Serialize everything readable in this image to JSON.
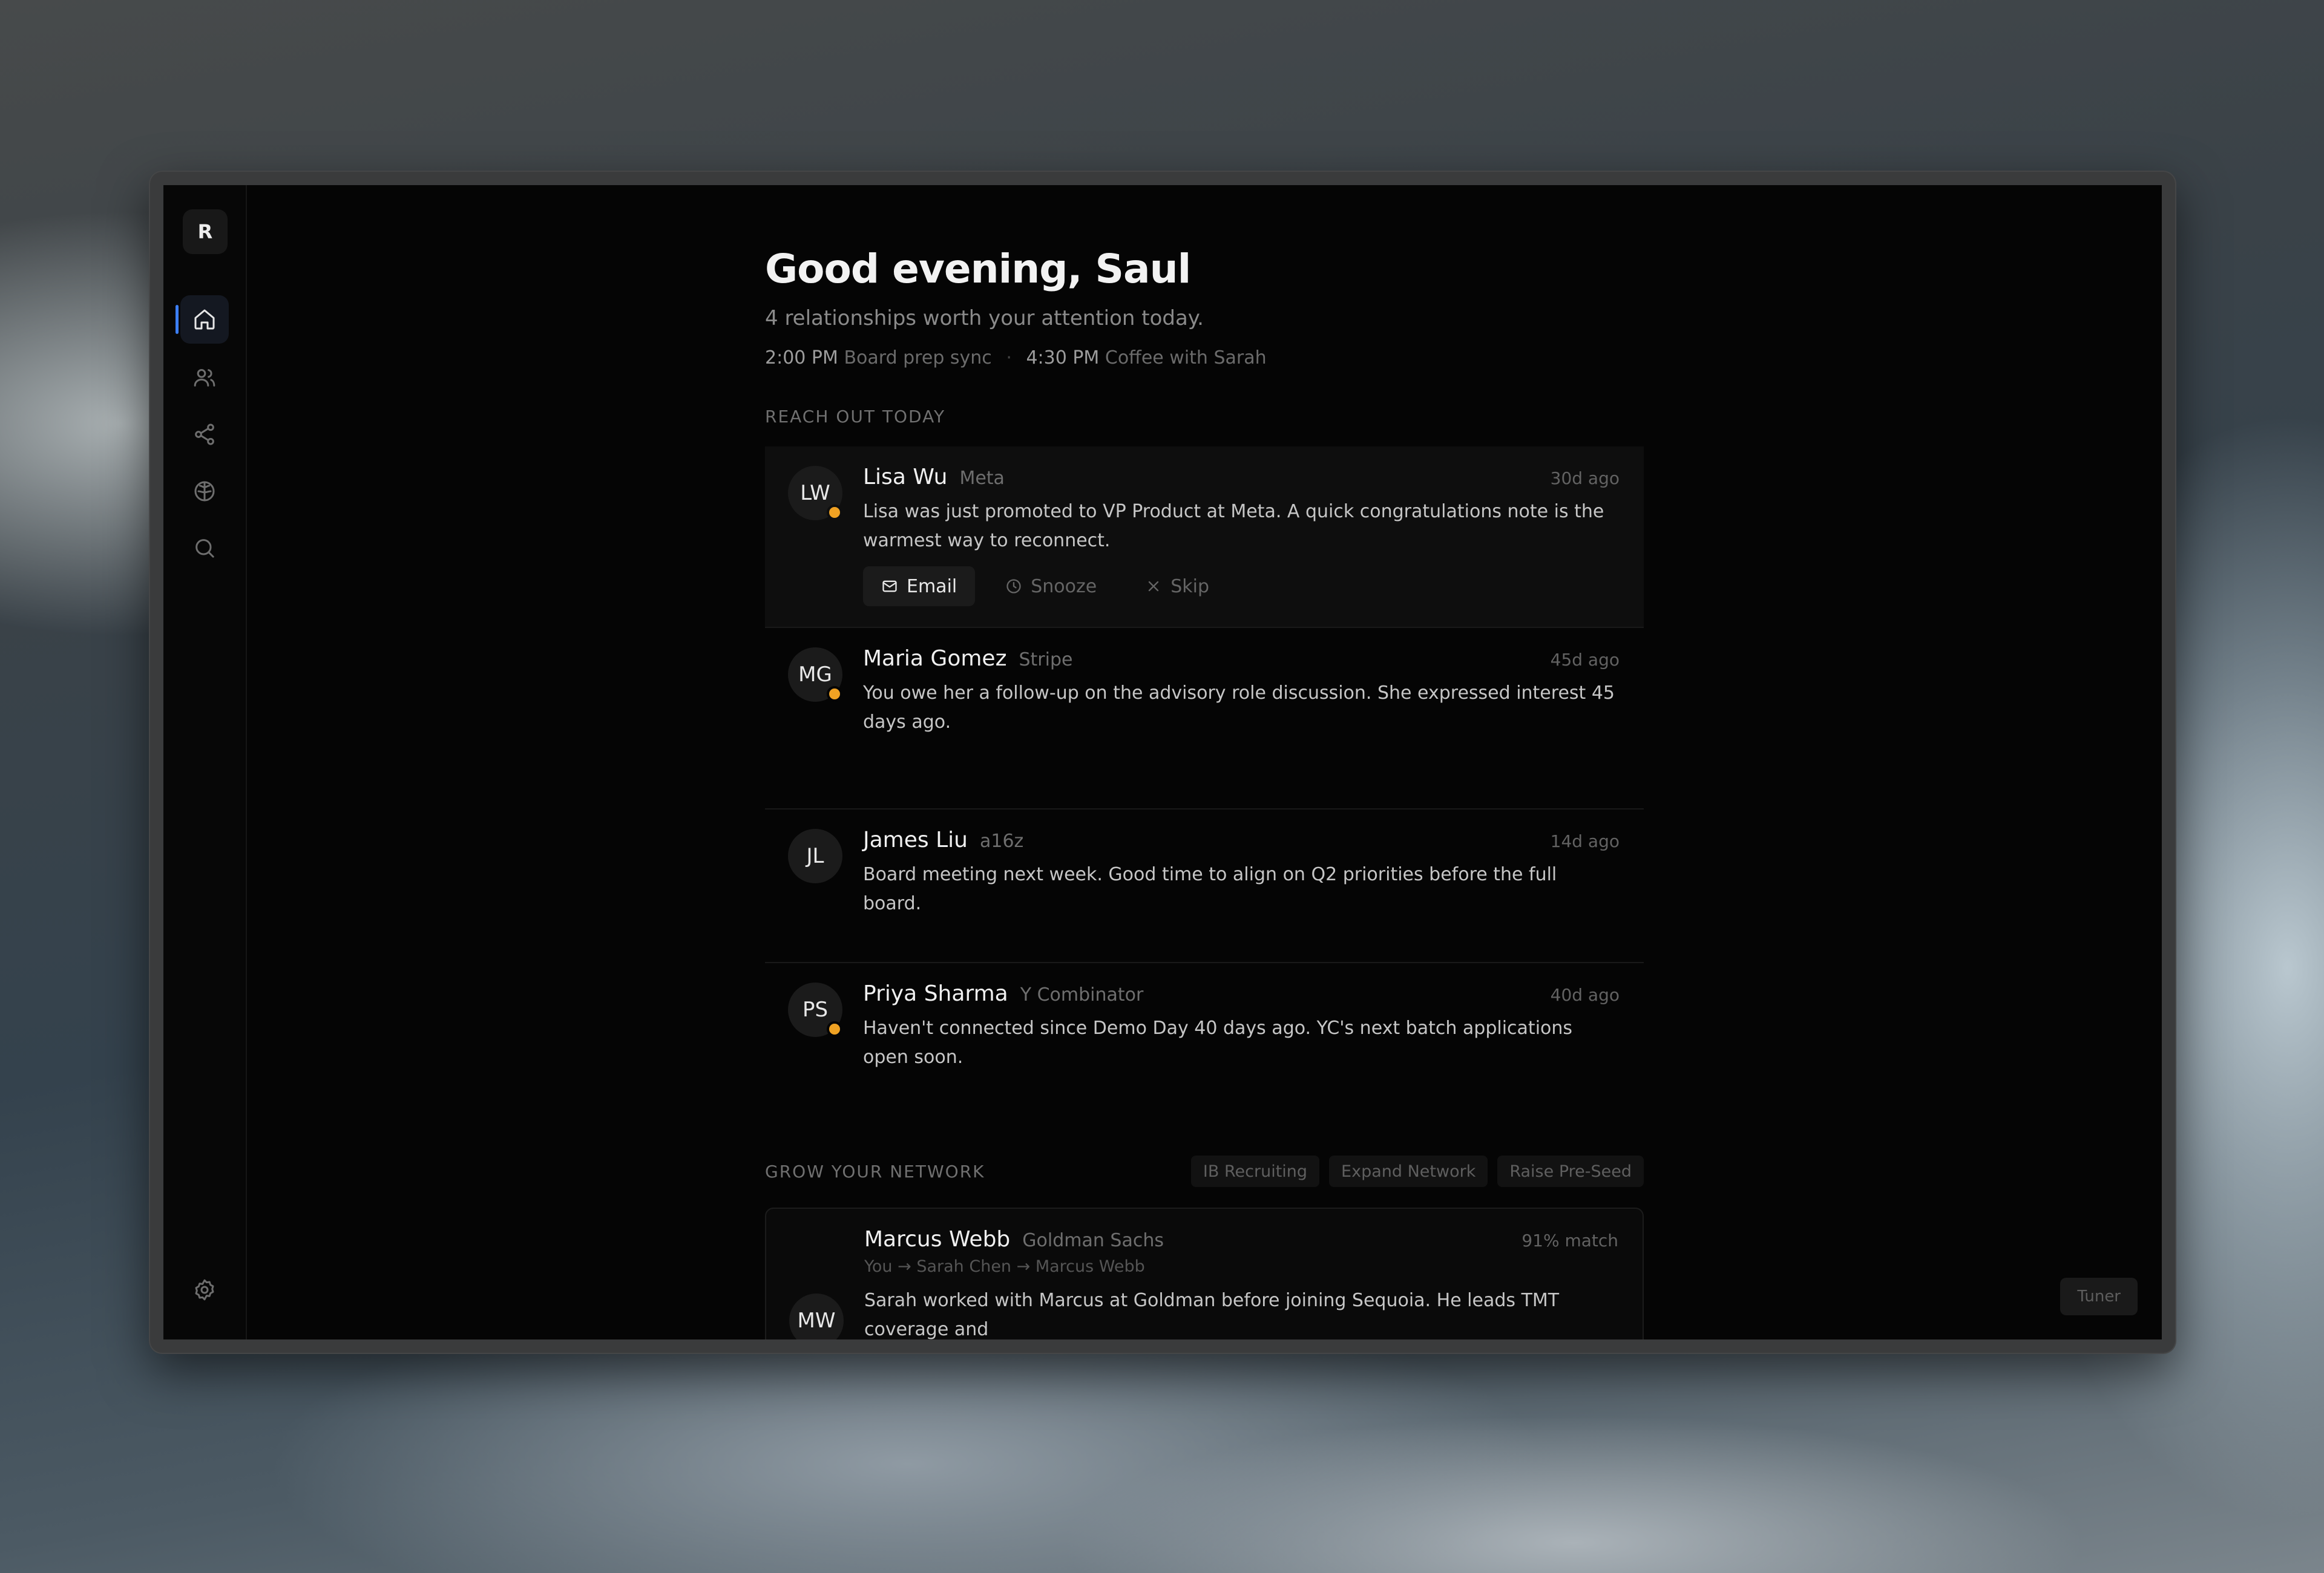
{
  "sidebar": {
    "logo_letter": "R",
    "items": [
      {
        "id": "home",
        "icon": "home-icon",
        "active": true
      },
      {
        "id": "people",
        "icon": "users-icon",
        "active": false
      },
      {
        "id": "network",
        "icon": "share-icon",
        "active": false
      },
      {
        "id": "brain",
        "icon": "brain-icon",
        "active": false
      },
      {
        "id": "search",
        "icon": "search-icon",
        "active": false
      }
    ],
    "settings_icon": "gear-icon"
  },
  "header": {
    "greeting": "Good evening, Saul",
    "subtitle": "4 relationships worth your attention today.",
    "schedule": [
      {
        "time": "2:00 PM",
        "title": "Board prep sync"
      },
      {
        "time": "4:30 PM",
        "title": "Coffee with Sarah"
      }
    ],
    "separator": "·"
  },
  "reach_out": {
    "label": "REACH OUT TODAY",
    "items": [
      {
        "initials": "LW",
        "name": "Lisa Wu",
        "company": "Meta",
        "ago": "30d ago",
        "message": "Lisa was just promoted to VP Product at Meta. A quick congratulations note is the warmest way to reconnect.",
        "status_dot": true,
        "actions": {
          "email": "Email",
          "snooze": "Snooze",
          "skip": "Skip"
        }
      },
      {
        "initials": "MG",
        "name": "Maria Gomez",
        "company": "Stripe",
        "ago": "45d ago",
        "message": "You owe her a follow-up on the advisory role discussion. She expressed interest 45 days ago.",
        "status_dot": true
      },
      {
        "initials": "JL",
        "name": "James Liu",
        "company": "a16z",
        "ago": "14d ago",
        "message": "Board meeting next week. Good time to align on Q2 priorities before the full board.",
        "status_dot": false
      },
      {
        "initials": "PS",
        "name": "Priya Sharma",
        "company": "Y Combinator",
        "ago": "40d ago",
        "message": "Haven't connected since Demo Day 40 days ago. YC's next batch applications open soon.",
        "status_dot": true
      }
    ]
  },
  "grow": {
    "label": "GROW YOUR NETWORK",
    "chips": [
      "IB Recruiting",
      "Expand Network",
      "Raise Pre-Seed"
    ],
    "match": {
      "initials": "MW",
      "name": "Marcus Webb",
      "company": "Goldman Sachs",
      "score": "91% match",
      "path": "You → Sarah Chen → Marcus Webb",
      "message": "Sarah worked with Marcus at Goldman before joining Sequoia. He leads TMT coverage and"
    }
  },
  "tuner": {
    "label": "Tuner"
  },
  "colors": {
    "accent": "#3c7ef3",
    "status": "#f0a223",
    "background": "#050505"
  }
}
